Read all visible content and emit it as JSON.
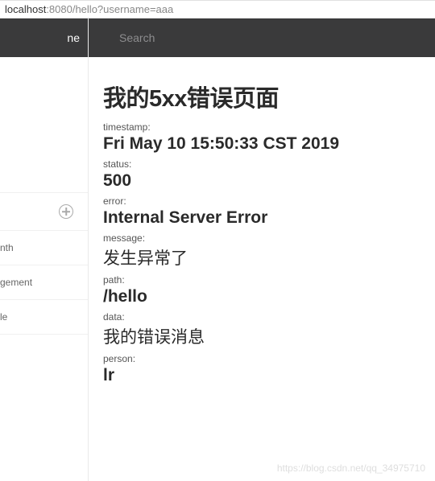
{
  "address": {
    "host": "localhost",
    "path": ":8080/hello?username=aaa"
  },
  "sidebar": {
    "top_label": "ne",
    "items": [
      {
        "label": ""
      },
      {
        "label": ""
      },
      {
        "label": "nth"
      },
      {
        "label": "gement"
      },
      {
        "label": "le"
      }
    ]
  },
  "search": {
    "placeholder": "Search"
  },
  "page": {
    "title": "我的5xx错误页面",
    "fields": {
      "timestamp": {
        "label": "timestamp:",
        "value": "Fri May 10 15:50:33 CST 2019"
      },
      "status": {
        "label": "status:",
        "value": "500"
      },
      "error": {
        "label": "error:",
        "value": "Internal Server Error"
      },
      "message": {
        "label": "message:",
        "value": "发生异常了"
      },
      "path": {
        "label": "path:",
        "value": "/hello"
      },
      "data": {
        "label": "data:",
        "value": "我的错误消息"
      },
      "person": {
        "label": "person:",
        "value": "lr"
      }
    }
  },
  "watermark": "https://blog.csdn.net/qq_34975710"
}
